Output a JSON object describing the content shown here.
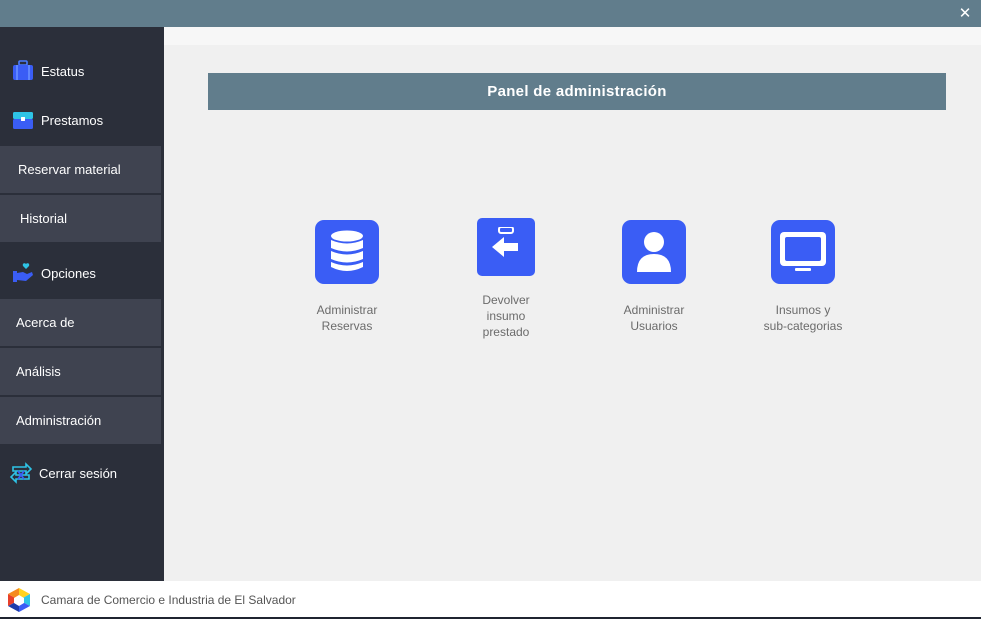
{
  "window": {
    "close_icon": "close-icon"
  },
  "sidebar": {
    "estatus": {
      "label": "Estatus",
      "icon": "briefcase-icon"
    },
    "prestamos": {
      "label": "Prestamos",
      "icon": "toolbox-icon"
    },
    "reservar": {
      "label": "Reservar material"
    },
    "historial": {
      "label": "Historial"
    },
    "opciones": {
      "label": "Opciones",
      "icon": "hand-heart-icon"
    },
    "acerca": {
      "label": "Acerca de"
    },
    "analisis": {
      "label": "Análisis"
    },
    "administracion": {
      "label": "Administración"
    },
    "cerrar": {
      "label": "Cerrar sesión",
      "icon": "logout-icon"
    }
  },
  "main": {
    "header": "Panel de administración",
    "tiles": [
      {
        "label": "Administrar\nReservas",
        "icon": "database-icon"
      },
      {
        "label": "Devolver\ninsumo\nprestado",
        "icon": "clipboard-return-icon"
      },
      {
        "label": "Administrar\nUsuarios",
        "icon": "user-icon"
      },
      {
        "label": "Insumos y\nsub-categorias",
        "icon": "monitor-icon"
      }
    ]
  },
  "footer": {
    "text": "Camara de Comercio e Industria de El Salvador"
  },
  "colors": {
    "accent": "#3a5df5",
    "header": "#617d8c",
    "sidebar": "#2b2f3a",
    "sidebar_sub": "#3f4350"
  }
}
